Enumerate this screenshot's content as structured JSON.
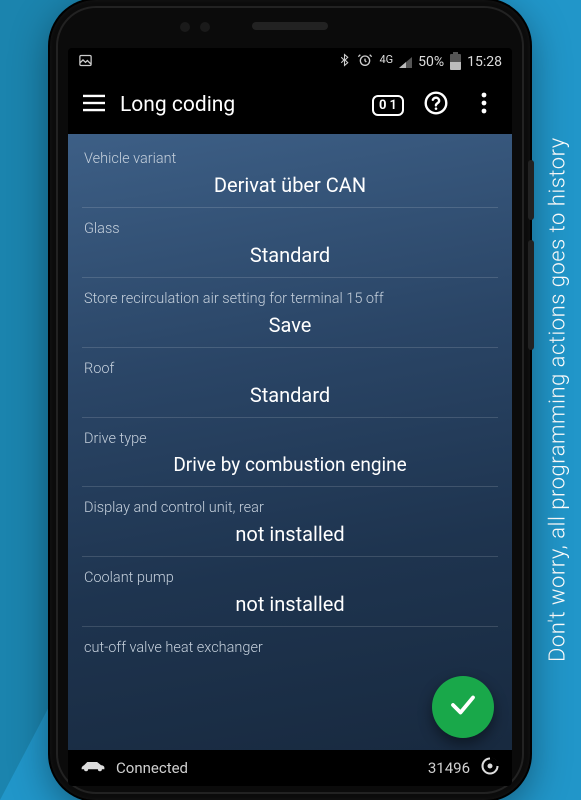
{
  "side_caption": "Don't worry, all programming actions goes to history",
  "status_bar": {
    "network_label": "4G",
    "battery_pct": "50%",
    "time": "15:28"
  },
  "app_bar": {
    "title": "Long coding",
    "badge_value": "1"
  },
  "settings": [
    {
      "label": "Vehicle variant",
      "value": "Derivat über CAN"
    },
    {
      "label": "Glass",
      "value": "Standard"
    },
    {
      "label": "Store recirculation air setting for terminal 15 off",
      "value": "Save"
    },
    {
      "label": "Roof",
      "value": "Standard"
    },
    {
      "label": "Drive type",
      "value": "Drive by combustion engine"
    },
    {
      "label": "Display and control unit, rear",
      "value": "not installed"
    },
    {
      "label": "Coolant pump",
      "value": "not installed"
    },
    {
      "label": "cut-off valve heat exchanger",
      "value": ""
    }
  ],
  "bottom_bar": {
    "status_text": "Connected",
    "counter": "31496"
  }
}
